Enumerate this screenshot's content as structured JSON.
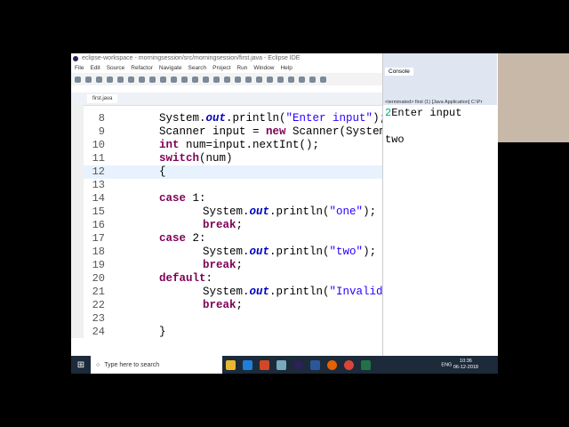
{
  "window": {
    "title": "eclipse-workspace - morningsession/src/morningsession/first.java - Eclipse IDE"
  },
  "menu": [
    "File",
    "Edit",
    "Source",
    "Refactor",
    "Navigate",
    "Search",
    "Project",
    "Run",
    "Window",
    "Help"
  ],
  "editor": {
    "tab": "first.java",
    "lines": [
      {
        "n": "8",
        "html": "System.<i class='fld'>out</i>.println(<span class='str'>\"Enter input\"</span>);",
        "indent": 1
      },
      {
        "n": "9",
        "html": "Scanner input = <span class='kw'>new</span> Scanner(System.<i class='fld'>in</i>);",
        "indent": 1
      },
      {
        "n": "10",
        "html": "<span class='kw'>int</span> num=input.nextInt();",
        "indent": 1
      },
      {
        "n": "11",
        "html": "<span class='kw'>switch</span>(num)",
        "indent": 1
      },
      {
        "n": "12",
        "html": "{",
        "indent": 1,
        "cur": true
      },
      {
        "n": "13",
        "html": "",
        "indent": 1
      },
      {
        "n": "14",
        "html": "<span class='kw'>case</span> 1:",
        "indent": 1
      },
      {
        "n": "15",
        "html": "System.<i class='fld'>out</i>.println(<span class='str'>\"one\"</span>);",
        "indent": 2
      },
      {
        "n": "16",
        "html": "<span class='kw'>break</span>;",
        "indent": 2
      },
      {
        "n": "17",
        "html": "<span class='kw'>case</span> 2:",
        "indent": 1
      },
      {
        "n": "18",
        "html": "System.<i class='fld'>out</i>.println(<span class='str'>\"two\"</span>);",
        "indent": 2
      },
      {
        "n": "19",
        "html": "<span class='kw'>break</span>;",
        "indent": 2
      },
      {
        "n": "20",
        "html": "<span class='kw'>default</span>:",
        "indent": 1
      },
      {
        "n": "21",
        "html": "System.<i class='fld'>out</i>.println(<span class='str'>\"Invalid\"</span>);",
        "indent": 2
      },
      {
        "n": "22",
        "html": "<span class='kw'>break</span>;",
        "indent": 2
      },
      {
        "n": "23",
        "html": "",
        "indent": 1
      },
      {
        "n": "24",
        "html": "}",
        "indent": 1
      }
    ]
  },
  "console": {
    "tab": "Console",
    "status": "<terminated> first (1) [Java Application] C:\\Pr",
    "input_line": "2",
    "prompt": "Enter input",
    "output": "two"
  },
  "taskbar": {
    "search_placeholder": "Type here to search",
    "lang": "ENG",
    "time": "10:36",
    "date": "06-12-2018"
  }
}
